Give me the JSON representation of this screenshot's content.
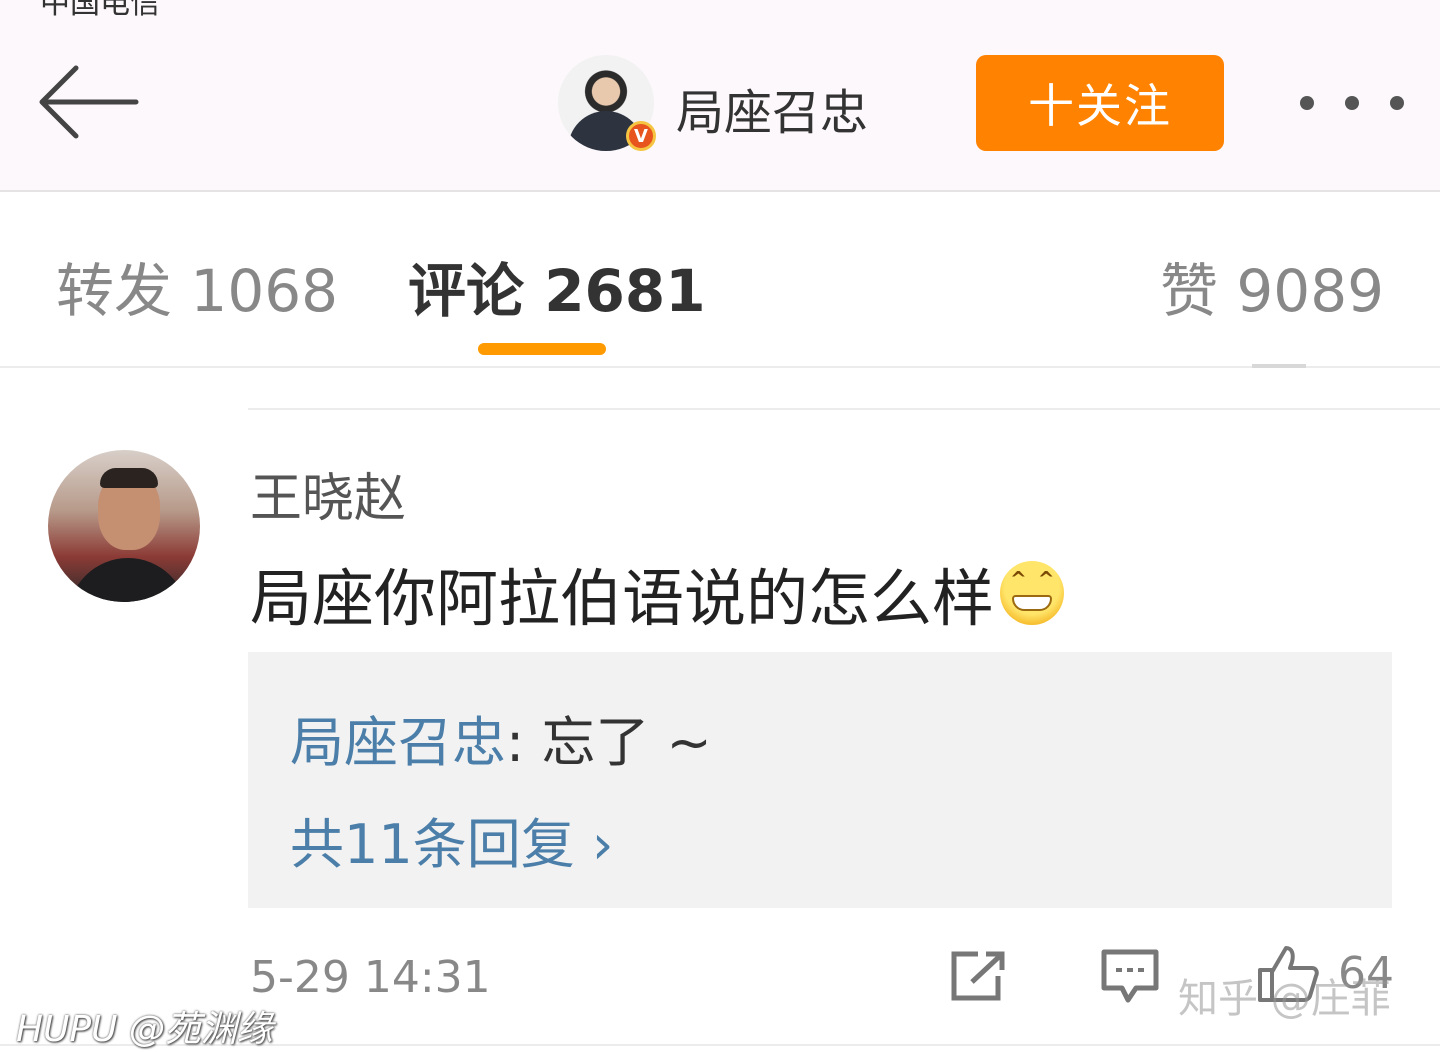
{
  "status_bar": {
    "fragment": "中国电信"
  },
  "header": {
    "name": "局座召忠",
    "verified_badge": "V",
    "follow_label": "十关注",
    "accent_color": "#ff8200"
  },
  "tabs": {
    "repost": "转发 1068",
    "comment": "评论 2681",
    "like": "赞 9089",
    "active": "comment",
    "underline_color": "#ff9a00"
  },
  "comment": {
    "user": "王晓赵",
    "text": "局座你阿拉伯语说的怎么样",
    "emoji": "grin-emoji",
    "reply": {
      "author": "局座召忠",
      "separator": ":",
      "content": " 忘了 ~",
      "more": "共11条回复 ›"
    },
    "time": "5-29 14:31",
    "like_count": "64",
    "link_color": "#4b7ea8"
  },
  "watermarks": {
    "left": "HUPU @苑渊缘",
    "right": "知乎 @庄菲"
  }
}
